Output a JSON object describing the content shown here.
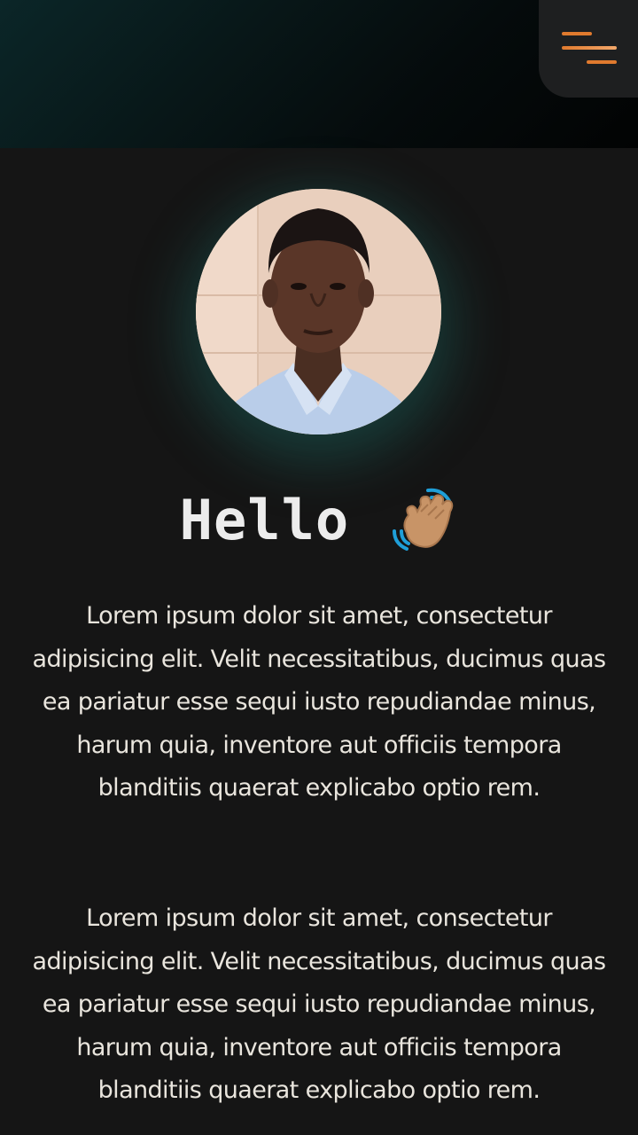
{
  "header": {
    "menu_icon": "hamburger-menu-icon",
    "accent_color": "#e07a2e"
  },
  "profile": {
    "avatar": "profile-photo",
    "glow_color": "#1e8278"
  },
  "greeting": {
    "text": "Hello",
    "emoji_icon": "waving-hand-icon"
  },
  "bio": {
    "paragraphs": [
      "Lorem ipsum dolor sit amet, consectetur adipisicing elit. Velit necessitatibus, ducimus quas ea pariatur esse sequi iusto repudiandae minus, harum quia, inventore aut officiis tempora blanditiis quaerat explicabo optio rem.",
      "Lorem ipsum dolor sit amet, consectetur adipisicing elit. Velit necessitatibus, ducimus quas ea pariatur esse sequi iusto repudiandae minus, harum quia, inventore aut officiis tempora blanditiis quaerat explicabo optio rem."
    ]
  }
}
